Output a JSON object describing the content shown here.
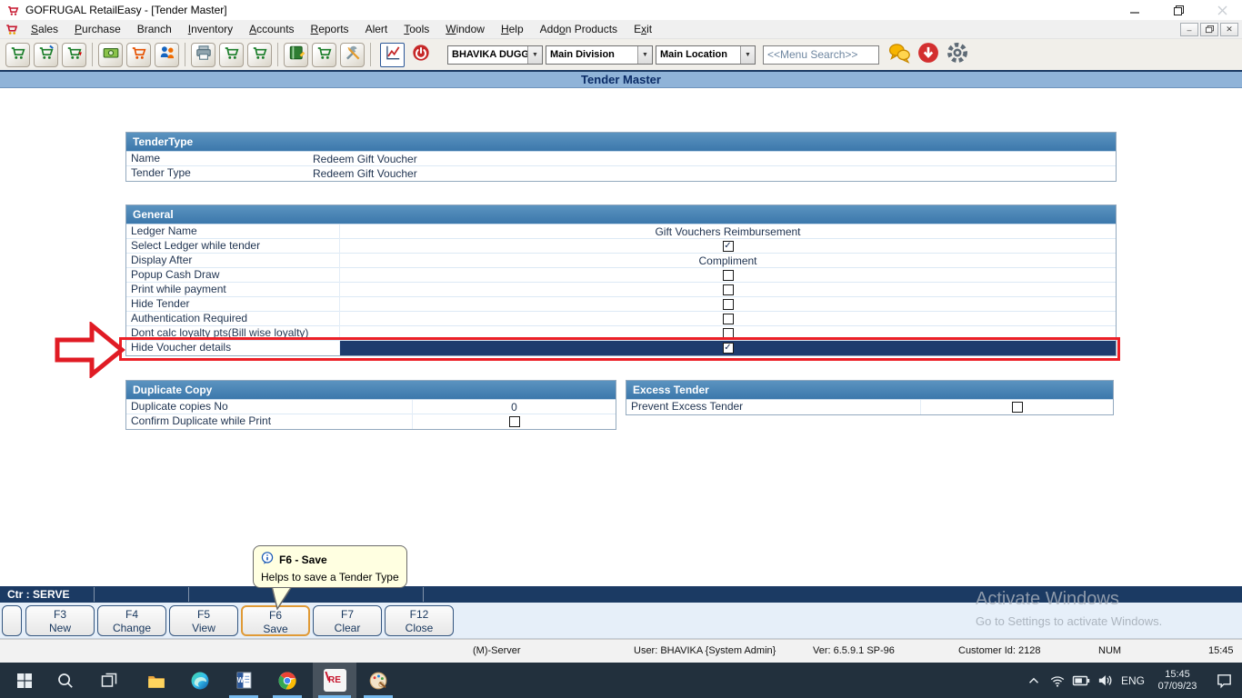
{
  "window": {
    "title": "GOFRUGAL RetailEasy - [Tender Master]",
    "controls": [
      "minimize",
      "restore",
      "close"
    ]
  },
  "menubar": {
    "items": [
      {
        "label": "Sales",
        "u": 0
      },
      {
        "label": "Purchase",
        "u": 0
      },
      {
        "label": "Branch",
        "u": -1
      },
      {
        "label": "Inventory",
        "u": 0
      },
      {
        "label": "Accounts",
        "u": 0
      },
      {
        "label": "Reports",
        "u": 0
      },
      {
        "label": "Alert",
        "u": -1
      },
      {
        "label": "Tools",
        "u": 0
      },
      {
        "label": "Window",
        "u": 0
      },
      {
        "label": "Help",
        "u": 0
      },
      {
        "label": "Addon Products",
        "u": 3
      },
      {
        "label": "Exit",
        "u": 1
      }
    ],
    "mdi_controls": [
      "minimize",
      "restore",
      "close"
    ]
  },
  "toolbar": {
    "icons": [
      "sales-cart",
      "sales-edit-cart",
      "sales-return-cart",
      "receipt-money",
      "purchase-cart",
      "customers",
      "printer",
      "bill-cart",
      "order-cart",
      "ledger-book",
      "stock-cart",
      "tools",
      "reports-chart",
      "power"
    ],
    "separators_after": [
      2,
      5,
      8,
      11
    ],
    "user_dropdown": "BHAVIKA DUGGA",
    "division_dropdown": "Main Division",
    "location_dropdown": "Main Location",
    "menu_search": "<<Menu Search>>",
    "right_icons": [
      "chat",
      "download",
      "settings"
    ]
  },
  "page": {
    "title": "Tender Master"
  },
  "tender_type": {
    "header": "TenderType",
    "rows": [
      {
        "label": "Name",
        "type": "text",
        "value": "Redeem Gift Voucher"
      },
      {
        "label": "Tender Type",
        "type": "text",
        "value": "Redeem Gift Voucher"
      }
    ]
  },
  "general": {
    "header": "General",
    "rows": [
      {
        "label": "Ledger Name",
        "type": "text",
        "value": "Gift Vouchers Reimbursement"
      },
      {
        "label": "Select Ledger while tender",
        "type": "checkbox",
        "checked": true
      },
      {
        "label": "Display After",
        "type": "text",
        "value": "Compliment"
      },
      {
        "label": "Popup Cash Draw",
        "type": "checkbox",
        "checked": false
      },
      {
        "label": "Print while payment",
        "type": "checkbox",
        "checked": false
      },
      {
        "label": "Hide Tender",
        "type": "checkbox",
        "checked": false
      },
      {
        "label": "Authentication Required",
        "type": "checkbox",
        "checked": false
      },
      {
        "label": "Dont calc loyalty pts(Bill wise loyalty)",
        "type": "checkbox",
        "checked": false
      },
      {
        "label": "Hide Voucher details",
        "type": "checkbox",
        "checked": true,
        "selected": true,
        "annotated": true
      }
    ]
  },
  "duplicate_copy": {
    "header": "Duplicate Copy",
    "rows": [
      {
        "label": "Duplicate copies No",
        "type": "text",
        "value": "0"
      },
      {
        "label": "Confirm Duplicate while Print",
        "type": "checkbox",
        "checked": false
      }
    ]
  },
  "excess_tender": {
    "header": "Excess Tender",
    "rows": [
      {
        "label": "Prevent Excess Tender",
        "type": "checkbox",
        "checked": false
      }
    ]
  },
  "tooltip": {
    "title": "F6 - Save",
    "text": "Helps to save a Tender Type"
  },
  "counter_bar": {
    "text": "Ctr : SERVE"
  },
  "function_buttons": [
    {
      "key": "F3",
      "label": "New"
    },
    {
      "key": "F4",
      "label": "Change"
    },
    {
      "key": "F5",
      "label": "View"
    },
    {
      "key": "F6",
      "label": "Save",
      "active": true
    },
    {
      "key": "F7",
      "label": "Clear"
    },
    {
      "key": "F12",
      "label": "Close"
    }
  ],
  "status_bar": {
    "server": "(M)-Server",
    "user": "User: BHAVIKA {System Admin}",
    "version": "Ver: 6.5.9.1 SP-96",
    "customer_id": "Customer Id: 2128",
    "num_lock": "NUM",
    "time": "15:45"
  },
  "watermark": {
    "line1": "Activate Windows",
    "line2": "Go to Settings to activate Windows."
  },
  "taskbar": {
    "icons": [
      {
        "name": "start"
      },
      {
        "name": "search"
      },
      {
        "name": "task-view"
      },
      {
        "name": "file-explorer"
      },
      {
        "name": "edge"
      },
      {
        "name": "word",
        "open": true
      },
      {
        "name": "chrome",
        "open": true
      },
      {
        "name": "retaileasy",
        "open": true,
        "active": true
      },
      {
        "name": "paint",
        "open": true
      }
    ],
    "tray": {
      "language": "ENG",
      "time": "15:45",
      "date": "07/09/23"
    }
  },
  "colors": {
    "section_header": "#4076A8",
    "selected_row": "#1E3C6E",
    "annotation": "#EC2027",
    "page_bar": "#8FB3D8",
    "counter_bar": "#1B3A63",
    "accent_orange": "#E09A36"
  }
}
